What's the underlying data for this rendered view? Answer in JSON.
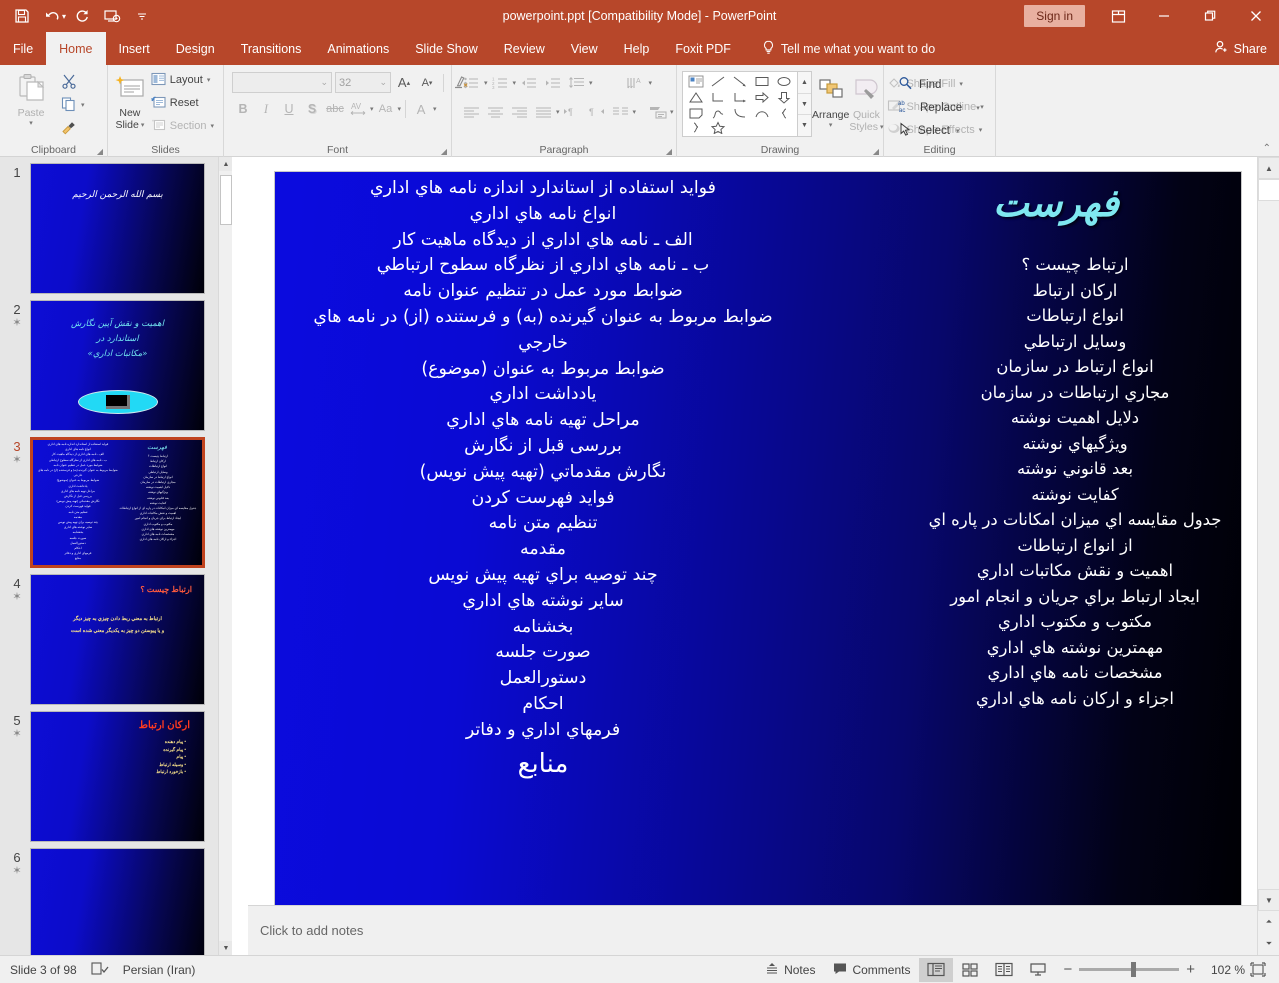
{
  "window": {
    "title": "powerpoint.ppt [Compatibility Mode]  -  PowerPoint",
    "signin": "Sign in",
    "share": "Share",
    "tellme": "Tell me what you want to do"
  },
  "quick_access": [
    "save-icon",
    "undo-icon",
    "redo-icon",
    "start-slideshow-icon",
    "customize-qat-icon"
  ],
  "tabs": [
    {
      "label": "File",
      "active": false
    },
    {
      "label": "Home",
      "active": true
    },
    {
      "label": "Insert",
      "active": false
    },
    {
      "label": "Design",
      "active": false
    },
    {
      "label": "Transitions",
      "active": false
    },
    {
      "label": "Animations",
      "active": false
    },
    {
      "label": "Slide Show",
      "active": false
    },
    {
      "label": "Review",
      "active": false
    },
    {
      "label": "View",
      "active": false
    },
    {
      "label": "Help",
      "active": false
    },
    {
      "label": "Foxit PDF",
      "active": false
    }
  ],
  "ribbon": {
    "clipboard": {
      "label": "Clipboard",
      "paste": "Paste",
      "items": [
        "cut-icon",
        "copy-icon",
        "format-painter-icon"
      ]
    },
    "slides": {
      "label": "Slides",
      "new_slide": "New\nSlide",
      "new_slide_l1": "New",
      "new_slide_l2": "Slide",
      "layout": "Layout",
      "reset": "Reset",
      "section": "Section"
    },
    "font": {
      "label": "Font",
      "font_name": "",
      "font_size": "32",
      "buttons": [
        "bold",
        "italic",
        "underline",
        "shadow",
        "strikethrough",
        "character-spacing",
        "change-case",
        "font-color"
      ]
    },
    "paragraph": {
      "label": "Paragraph"
    },
    "drawing": {
      "label": "Drawing",
      "arrange": "Arrange",
      "quick_styles_l1": "Quick",
      "quick_styles_l2": "Styles",
      "shape_fill": "Shape Fill",
      "shape_outline": "Shape Outline",
      "shape_effects": "Shape Effects"
    },
    "editing": {
      "label": "Editing",
      "find": "Find",
      "replace": "Replace",
      "select": "Select"
    }
  },
  "thumbnails": [
    {
      "number": "1",
      "animated": false,
      "selected": false,
      "lines": [
        "بسم الله الرحمن الرحيم"
      ]
    },
    {
      "number": "2",
      "animated": true,
      "selected": false,
      "lines": [
        "اهميت و نقش آيين نگارش",
        "استاندارد در",
        "«مكاتبات اداري»"
      ]
    },
    {
      "number": "3",
      "animated": true,
      "selected": true,
      "lines": [
        "فهرست"
      ]
    },
    {
      "number": "4",
      "animated": true,
      "selected": false,
      "title": "ارتباط چيست ؟",
      "lines": [
        "ارتباط به معني ربط دادن چيزي به چيز ديگر",
        "و يا پيوستن دو چيز به يكديگر معني شده است"
      ]
    },
    {
      "number": "5",
      "animated": true,
      "selected": false,
      "title": "اركان ارتباط",
      "lines": [
        "پيام دهنده",
        "پيام گيرنده",
        "پيام",
        "وسيله ارتباط",
        "بازخورد ارتباط"
      ]
    },
    {
      "number": "6",
      "animated": true,
      "selected": false,
      "lines": []
    }
  ],
  "slide": {
    "title": "فهرست",
    "title_color": "#7fe8f0",
    "background_from": "#0b0bdf",
    "background_to": "#000004",
    "right_column": [
      "ارتباط چيست ؟",
      "اركان ارتباط",
      "انواع ارتباطات",
      "وسايل ارتباطي",
      "انواع ارتباط در سازمان",
      "مجاري ارتباطات در سازمان",
      "دلايل اهميت نوشته",
      "ويژگيهاي نوشته",
      "بعد قانوني نوشته",
      "كفايت نوشته",
      "جدول مقايسه اي ميزان امكانات در پاره اي از انواع ارتباطات",
      "اهميت و نقش مكاتبات اداري",
      "ايجاد ارتباط براي جريان و انجام امور",
      "مكتوب و مكتوب اداري",
      "مهمترين نوشته هاي اداري",
      "مشخصات نامه هاي اداري",
      "اجزاء و اركان نامه هاي اداري"
    ],
    "left_column": [
      "فوايد استفاده از استاندارد اندازه نامه هاي اداري",
      "انواع نامه هاي اداري",
      "الف ـ نامه هاي اداري از ديدگاه ماهيت كار",
      "ب ـ نامه هاي اداري از نظرگاه سطوح ارتباطي",
      "ضوابط مورد عمل در تنظيم عنوان نامه",
      "ضوابط مربوط به عنوان گيرنده (به) و فرستنده (از) در نامه هاي خارجي",
      "ضوابط مربوط به عنوان (موضوع)",
      "يادداشت اداري",
      "مراحل تهيه نامه هاي اداري",
      "بررسی قبل از نگارش",
      "نگارش مقدماتي (تهيه پيش نويس)",
      "فوايد فهرست كردن",
      "تنظيم متن نامه",
      "مقدمه",
      "چند توصيه براي تهيه پيش نويس",
      "ساير نوشته هاي اداري",
      "بخشنامه",
      "صورت جلسه",
      "دستورالعمل",
      "احكام",
      "فرمهاي اداري و دفاتر"
    ],
    "left_column_last": "منابع"
  },
  "notes": {
    "placeholder": "Click to add notes"
  },
  "status": {
    "slide_counter": "Slide 3 of 98",
    "language": "Persian (Iran)",
    "notes_label": "Notes",
    "comments_label": "Comments",
    "zoom": "102 %",
    "views": [
      "normal-view",
      "slide-sorter-view",
      "reading-view",
      "slide-show-view"
    ]
  }
}
